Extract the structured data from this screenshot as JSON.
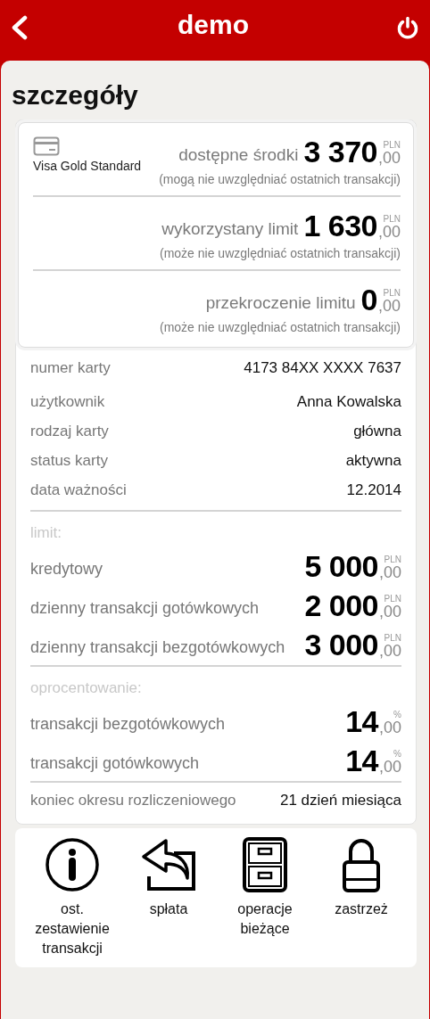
{
  "header": {
    "title": "demo"
  },
  "page_title": "szczegóły",
  "balances": {
    "card_name": "Visa Gold Standard",
    "items": [
      {
        "label": "dostępne środki",
        "amount": "3 370",
        "decimals": ",00",
        "currency": "PLN",
        "note": "(mogą nie uwzględniać ostatnich transakcji)"
      },
      {
        "label": "wykorzystany limit",
        "amount": "1 630",
        "decimals": ",00",
        "currency": "PLN",
        "note": "(może nie uwzględniać ostatnich transakcji)"
      },
      {
        "label": "przekroczenie limitu",
        "amount": "0",
        "decimals": ",00",
        "currency": "PLN",
        "note": "(może nie uwzględniać ostatnich transakcji)"
      }
    ]
  },
  "details": [
    {
      "label": "numer karty",
      "value": "4173 84XX XXXX 7637"
    },
    {
      "label": "użytkownik",
      "value": "Anna Kowalska"
    },
    {
      "label": "rodzaj karty",
      "value": "główna"
    },
    {
      "label": "status karty",
      "value": "aktywna"
    },
    {
      "label": "data ważności",
      "value": "12.2014"
    }
  ],
  "limit": {
    "heading": "limit:",
    "rows": [
      {
        "label": "kredytowy",
        "amount": "5 000",
        "decimals": ",00",
        "currency": "PLN"
      },
      {
        "label": "dzienny transakcji gotówkowych",
        "amount": "2 000",
        "decimals": ",00",
        "currency": "PLN"
      },
      {
        "label": "dzienny transakcji bezgotówkowych",
        "amount": "3 000",
        "decimals": ",00",
        "currency": "PLN"
      }
    ]
  },
  "interest": {
    "heading": "oprocentowanie:",
    "rows": [
      {
        "label": "transakcji bezgotówkowych",
        "amount": "14",
        "decimals": ",00",
        "currency": "%"
      },
      {
        "label": "transakcji gotówkowych",
        "amount": "14",
        "decimals": ",00",
        "currency": "%"
      }
    ]
  },
  "billing": {
    "label": "koniec okresu rozliczeniowego",
    "value": "21 dzień miesiąca"
  },
  "actions": [
    {
      "kind": "info",
      "label": "ost. zestawienie transakcji"
    },
    {
      "kind": "repay",
      "label": "spłata"
    },
    {
      "kind": "cabinet",
      "label": "operacje bieżące"
    },
    {
      "kind": "lock",
      "label": "zastrzeż"
    }
  ]
}
